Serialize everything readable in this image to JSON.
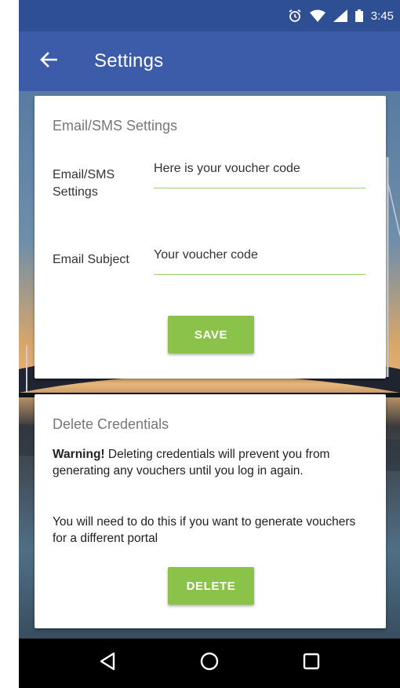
{
  "status_bar": {
    "time": "3:45",
    "icons": [
      "alarm-icon",
      "wifi-icon",
      "signal-icon",
      "battery-icon"
    ]
  },
  "app_bar": {
    "title": "Settings",
    "back_icon": "arrow-left-icon"
  },
  "email_sms_card": {
    "title": "Email/SMS Settings",
    "fields": [
      {
        "label": "Email/SMS Settings",
        "value": "Here is your voucher code"
      },
      {
        "label": "Email Subject",
        "value": "Your voucher code"
      }
    ],
    "save_label": "SAVE"
  },
  "delete_card": {
    "title": "Delete Credentials",
    "warning_bold": "Warning!",
    "warning_text": " Deleting credentials will prevent you from generating any vouchers until you log in again.",
    "note": "You will need to do this if you want to generate vouchers for a different portal",
    "delete_label": "DELETE"
  },
  "nav_bar": {
    "buttons": [
      "back-triangle-icon",
      "home-circle-icon",
      "recents-square-icon"
    ]
  },
  "colors": {
    "status_bar": "#2f4f94",
    "app_bar": "#3c5ba9",
    "accent_button": "#8bc34a",
    "input_underline": "#9ccf6a"
  }
}
